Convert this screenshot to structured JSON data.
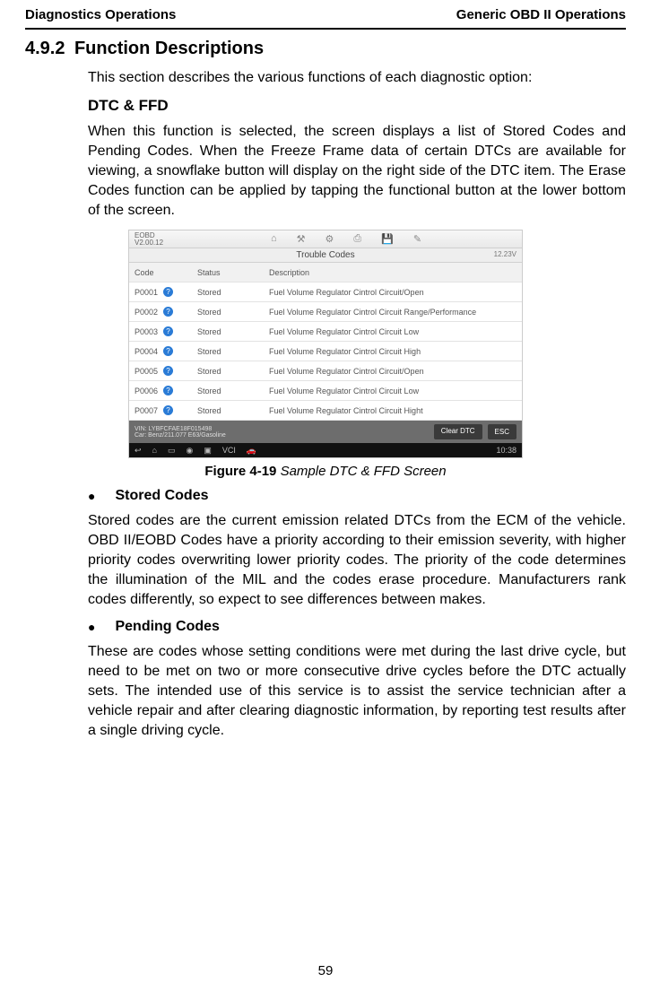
{
  "header": {
    "left": "Diagnostics Operations",
    "right": "Generic OBD II Operations"
  },
  "section": {
    "number": "4.9.2",
    "title": "Function Descriptions"
  },
  "intro": "This section describes the various functions of each diagnostic option:",
  "sub1": {
    "title": "DTC & FFD",
    "para": "When this function is selected, the screen displays a list of Stored Codes and Pending Codes. When the Freeze Frame data of certain DTCs are available for viewing, a snowflake button will display on the right side of the DTC item. The Erase Codes function can be applied by tapping the functional button at the lower bottom of the screen."
  },
  "figure": {
    "brand1": "EOBD",
    "brand2": "V2.00.12",
    "titlebar": "Trouble Codes",
    "voltage": "12.23V",
    "headers": {
      "code": "Code",
      "status": "Status",
      "desc": "Description"
    },
    "rows": [
      {
        "code": "P0001",
        "status": "Stored",
        "desc": "Fuel Volume Regulator Cintrol Circuit/Open"
      },
      {
        "code": "P0002",
        "status": "Stored",
        "desc": "Fuel Volume Regulator Cintrol Circuit Range/Performance"
      },
      {
        "code": "P0003",
        "status": "Stored",
        "desc": "Fuel Volume Regulator Cintrol Circuit Low"
      },
      {
        "code": "P0004",
        "status": "Stored",
        "desc": "Fuel Volume Regulator Cintrol Circuit High"
      },
      {
        "code": "P0005",
        "status": "Stored",
        "desc": "Fuel Volume Regulator Cintrol Circuit/Open"
      },
      {
        "code": "P0006",
        "status": "Stored",
        "desc": "Fuel Volume Regulator Cintrol Circuit Low"
      },
      {
        "code": "P0007",
        "status": "Stored",
        "desc": "Fuel Volume Regulator Cintrol Circuit Hight"
      }
    ],
    "vin": "VIN: LYBFCFAE18F015498",
    "car": "Car: Benz/211.077 E63/Gasoline",
    "btn_clear": "Clear DTC",
    "btn_esc": "ESC",
    "clock": "10:38"
  },
  "caption": {
    "num": "Figure 4-19",
    "text": " Sample DTC & FFD Screen"
  },
  "bullet1": {
    "label": "Stored Codes",
    "para": "Stored codes are the current emission related DTCs from the ECM of the vehicle. OBD II/EOBD Codes have a priority according to their emission severity, with higher priority codes overwriting lower priority codes. The priority of the code determines the illumination of the MIL and the codes erase procedure. Manufacturers rank codes differently, so expect to see differences between makes."
  },
  "bullet2": {
    "label": "Pending Codes",
    "para": "These are codes whose setting conditions were met during the last drive cycle, but need to be met on two or more consecutive drive cycles before the DTC actually sets. The intended use of this service is to assist the service technician after a vehicle repair and after clearing diagnostic information, by reporting test results after a single driving cycle."
  },
  "pagenum": "59"
}
